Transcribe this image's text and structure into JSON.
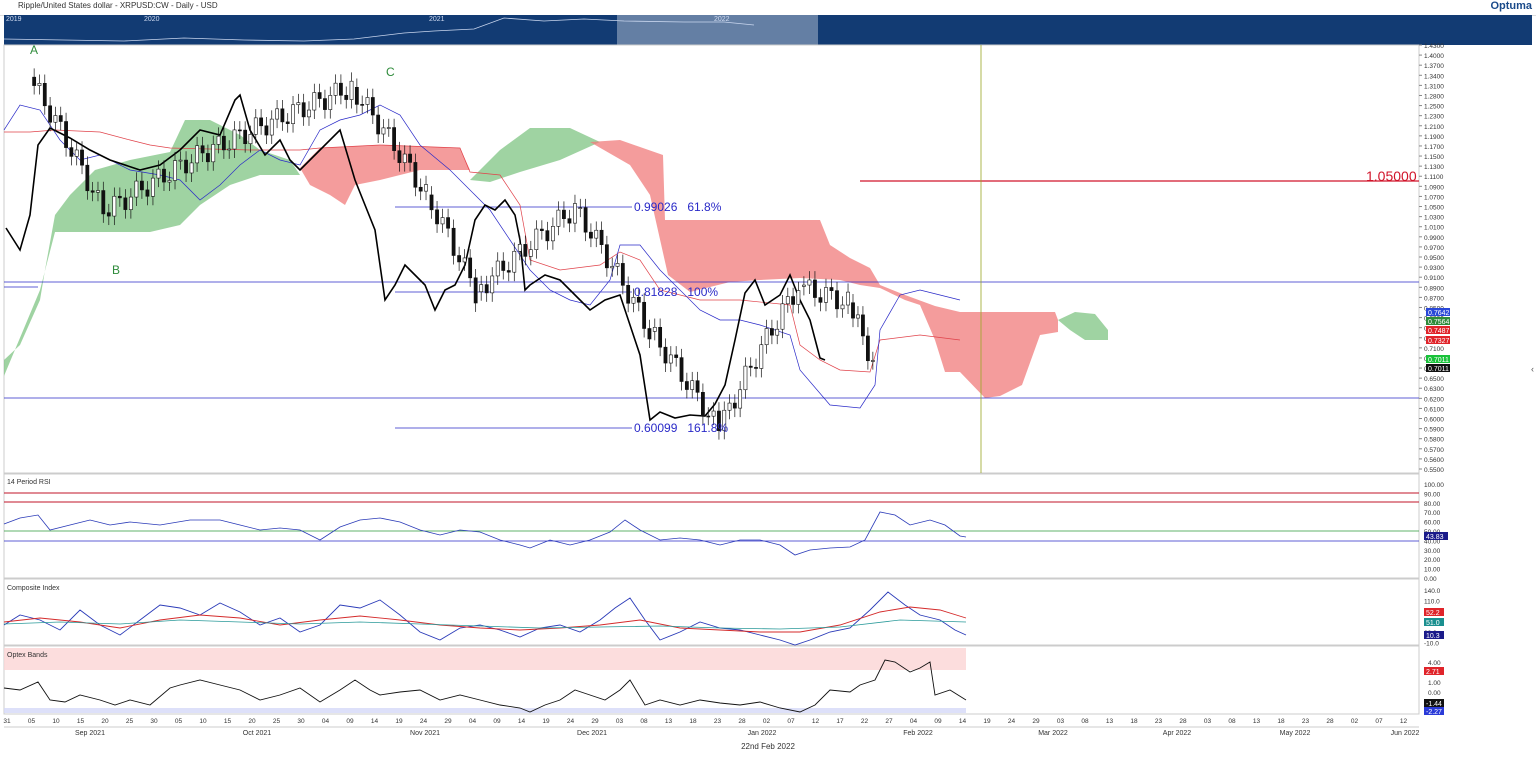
{
  "header": {
    "title": "Ripple/United States dollar - XRPUSD:CW - Daily - USD",
    "brand": "Optuma"
  },
  "navigator": {
    "years": [
      "2019",
      "2020",
      "2021",
      "2022"
    ]
  },
  "main_chart": {
    "ticks": [
      "1.4300",
      "1.4000",
      "1.3700",
      "1.3400",
      "1.3100",
      "1.2800",
      "1.2500",
      "1.2300",
      "1.2100",
      "1.1900",
      "1.1700",
      "1.1500",
      "1.1300",
      "1.1100",
      "1.0900",
      "1.0700",
      "1.0500",
      "1.0300",
      "1.0100",
      "0.9900",
      "0.9700",
      "0.9500",
      "0.9300",
      "0.9100",
      "0.8900",
      "0.8700",
      "0.8500",
      "0.8300",
      "0.8100",
      "0.7900",
      "0.7100",
      "0.6900",
      "0.6700",
      "0.6500",
      "0.6300",
      "0.6200",
      "0.6100",
      "0.6000",
      "0.5900",
      "0.5800",
      "0.5700",
      "0.5600",
      "0.5500"
    ],
    "labels": {
      "A": "A",
      "B": "B",
      "C": "C",
      "target": "1.05000",
      "fib1": "0.99026   61.8%",
      "fib2": "0.81828   100%",
      "fib3": "0.60099   161.8%"
    },
    "badges": [
      {
        "text": "0.7642",
        "color": "#2a48d8"
      },
      {
        "text": "0.7564",
        "color": "#2e8b3a"
      },
      {
        "text": "0.7487",
        "color": "#e0242a"
      },
      {
        "text": "0.7327",
        "color": "#e0242a"
      },
      {
        "text": "0.7011",
        "color": "#19c23a"
      },
      {
        "text": "0.7011",
        "color": "#111111"
      }
    ]
  },
  "rsi_panel": {
    "title": "14 Period RSI",
    "ticks": [
      "100.00",
      "90.00",
      "80.00",
      "70.00",
      "60.00",
      "50.00",
      "40.00",
      "30.00",
      "20.00",
      "10.00",
      "0.00"
    ],
    "badge": "43.83"
  },
  "composite_panel": {
    "title": "Composite Index",
    "ticks": [
      "140.0",
      "110.0",
      "80.0",
      "50.0",
      "20.0",
      "-10.0"
    ],
    "badges": [
      "52.2",
      "51.0",
      "10.3"
    ]
  },
  "optex_panel": {
    "title": "Optex Bands",
    "ticks": [
      "4.00",
      "2.00",
      "1.00",
      "0.00"
    ],
    "badges": [
      "2.71",
      "-1.44",
      "-2.27"
    ]
  },
  "x_axis": {
    "days": [
      "31",
      "05",
      "10",
      "15",
      "20",
      "25",
      "30",
      "05",
      "10",
      "15",
      "20",
      "25",
      "30",
      "04",
      "09",
      "14",
      "19",
      "24",
      "29",
      "04",
      "09",
      "14",
      "19",
      "24",
      "29",
      "03",
      "08",
      "13",
      "18",
      "23",
      "28",
      "02",
      "07",
      "12",
      "17",
      "22",
      "27",
      "04",
      "09",
      "14",
      "19",
      "24",
      "29",
      "03",
      "08",
      "13",
      "18",
      "23",
      "28",
      "03",
      "08",
      "13",
      "18",
      "23",
      "28",
      "02",
      "07",
      "12"
    ],
    "months": [
      "Sep 2021",
      "Oct 2021",
      "Nov 2021",
      "Dec 2021",
      "Jan 2022",
      "Feb 2022",
      "Mar 2022",
      "Apr 2022",
      "May 2022",
      "Jun 2022"
    ],
    "date_label": "22nd Feb 2022"
  },
  "chart_data": {
    "type": "candlestick",
    "title": "Ripple/United States dollar - XRPUSD:CW - Daily - USD",
    "x_range": [
      "2021-08-31",
      "2022-06-12"
    ],
    "ylim": [
      0.55,
      1.43
    ],
    "scale": "log",
    "close_approx": [
      {
        "date": "2021-09-05",
        "close": 1.33
      },
      {
        "date": "2021-09-20",
        "close": 0.98
      },
      {
        "date": "2021-10-10",
        "close": 1.12
      },
      {
        "date": "2021-11-09",
        "close": 1.3
      },
      {
        "date": "2021-11-24",
        "close": 1.02
      },
      {
        "date": "2021-12-04",
        "close": 0.82
      },
      {
        "date": "2021-12-24",
        "close": 0.99
      },
      {
        "date": "2022-01-08",
        "close": 0.75
      },
      {
        "date": "2022-01-22",
        "close": 0.6
      },
      {
        "date": "2022-02-07",
        "close": 0.83
      },
      {
        "date": "2022-02-17",
        "close": 0.8
      },
      {
        "date": "2022-02-22",
        "close": 0.7
      }
    ],
    "horizontal_levels": [
      1.05,
      0.99026,
      0.81828,
      0.60099
    ],
    "fib_labels": [
      "61.8%",
      "100%",
      "161.8%"
    ],
    "indicators": {
      "rsi_14": {
        "last": 43.83,
        "bands": [
          90,
          80,
          50,
          40
        ]
      },
      "composite_index": {
        "last": [
          52.2,
          51.0,
          10.3
        ]
      },
      "optex_bands": {
        "last": [
          2.71,
          -1.44,
          -2.27
        ]
      }
    }
  }
}
